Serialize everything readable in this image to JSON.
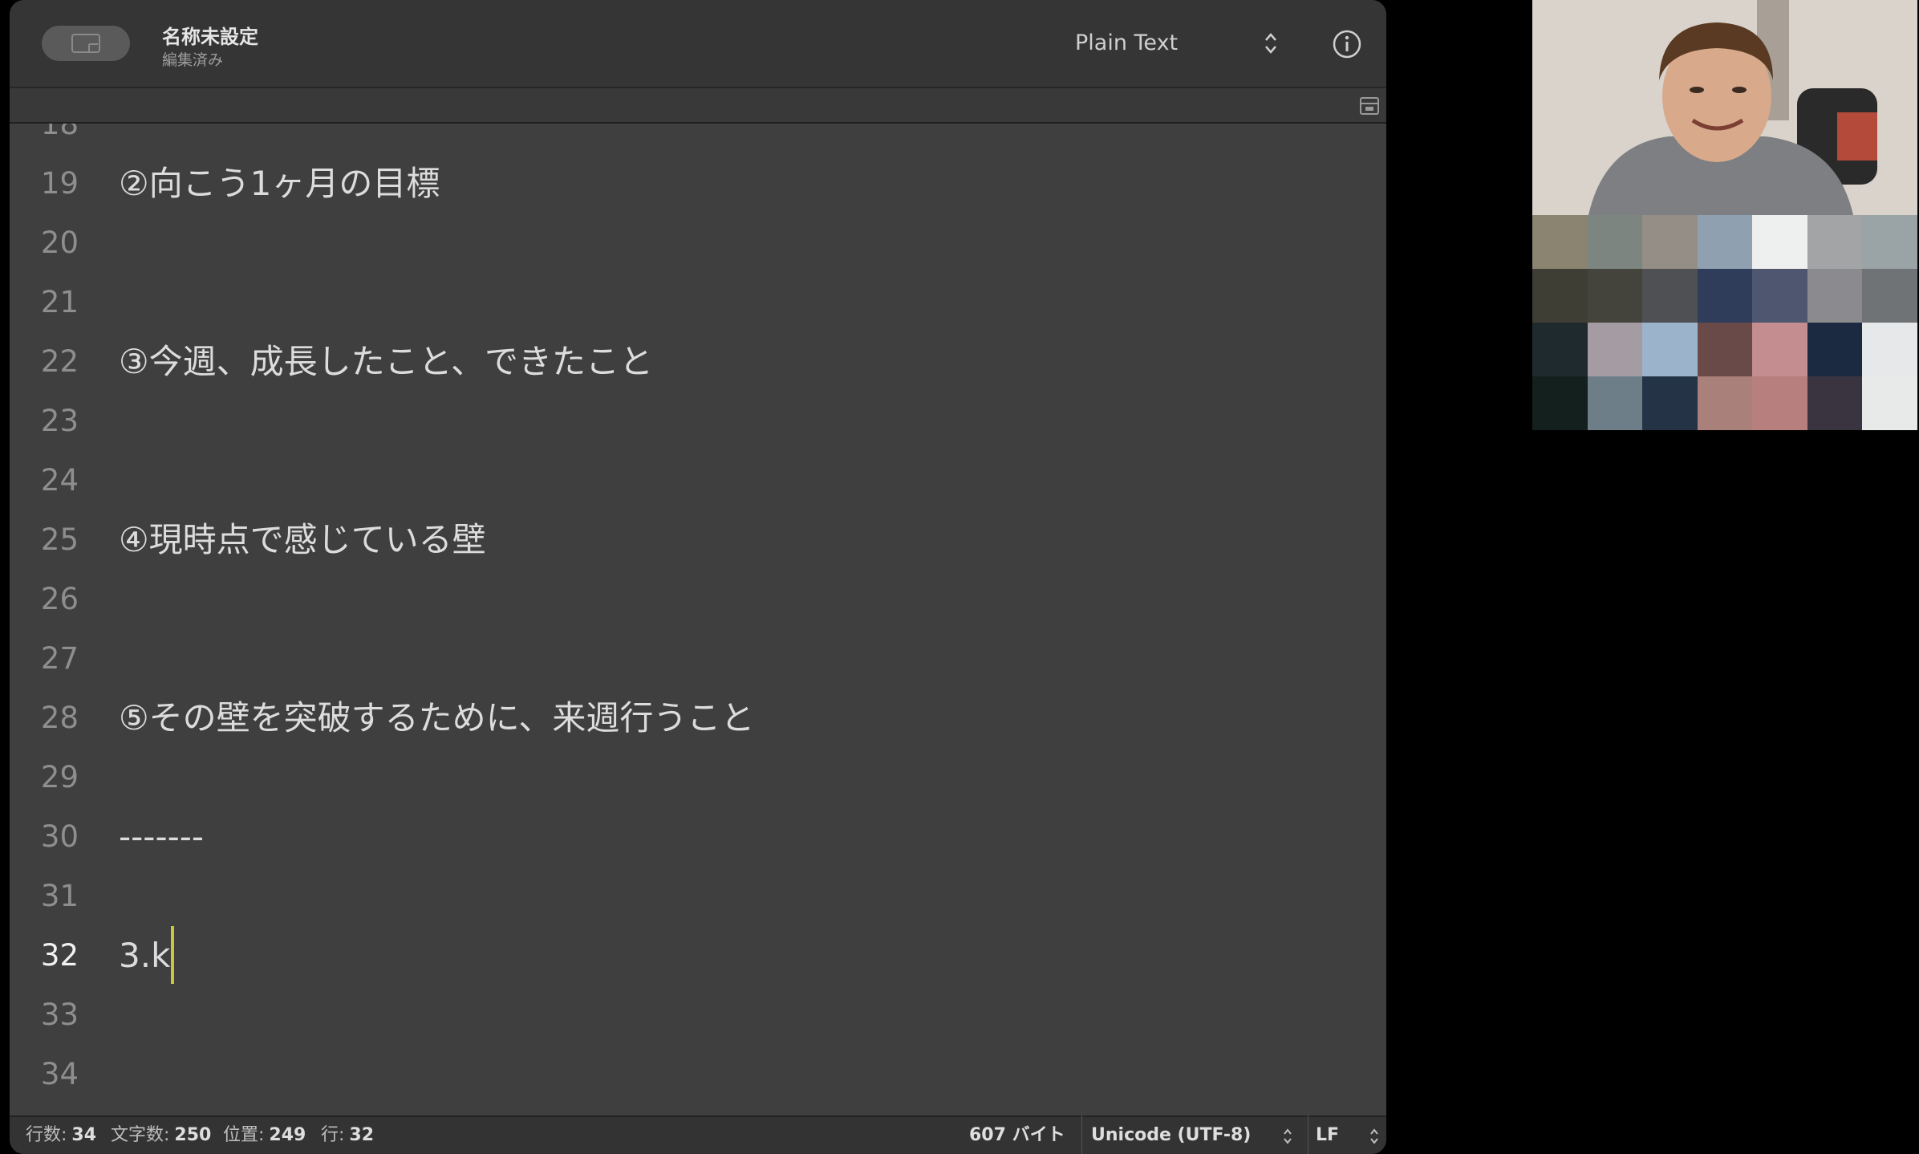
{
  "window": {
    "title": "名称未設定",
    "subtitle": "編集済み",
    "syntax": "Plain Text"
  },
  "editor": {
    "lines": [
      {
        "number": "19",
        "text": "②向こう1ヶ月の目標"
      },
      {
        "number": "20",
        "text": ""
      },
      {
        "number": "21",
        "text": ""
      },
      {
        "number": "22",
        "text": "③今週、成長したこと、できたこと"
      },
      {
        "number": "23",
        "text": ""
      },
      {
        "number": "24",
        "text": ""
      },
      {
        "number": "25",
        "text": "④現時点で感じている壁"
      },
      {
        "number": "26",
        "text": ""
      },
      {
        "number": "27",
        "text": ""
      },
      {
        "number": "28",
        "text": "⑤その壁を突破するために、来週行うこと"
      },
      {
        "number": "29",
        "text": ""
      },
      {
        "number": "30",
        "text": "-------"
      },
      {
        "number": "31",
        "text": ""
      },
      {
        "number": "32",
        "text": "3.k"
      },
      {
        "number": "33",
        "text": ""
      },
      {
        "number": "34",
        "text": ""
      }
    ],
    "current_line": "32"
  },
  "status": {
    "lines_label": "行数:",
    "lines_value": "34",
    "chars_label": "文字数:",
    "chars_value": "250",
    "position_label": "位置:",
    "position_value": "249",
    "row_label": "行:",
    "row_value": "32",
    "bytes": "607 バイト",
    "encoding": "Unicode (UTF-8)",
    "line_ending": "LF"
  },
  "colors": {
    "editor_bg": "#3f3f3f",
    "caret": "#c9c83b"
  }
}
